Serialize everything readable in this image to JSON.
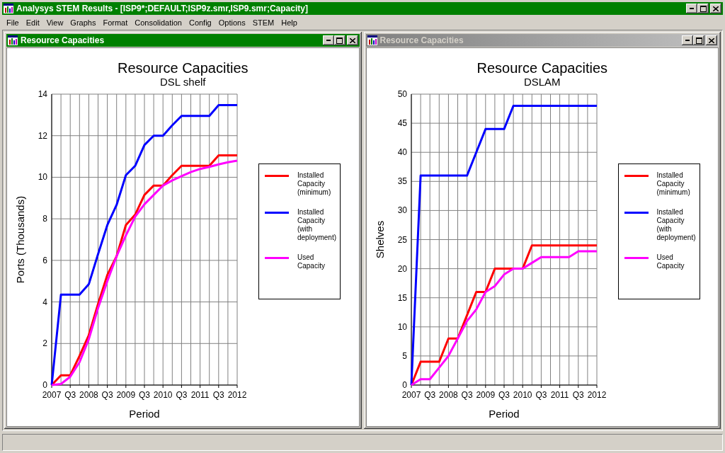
{
  "window": {
    "title": "Analysys STEM Results - [ISP9*;DEFAULT;ISP9z.smr,ISP9.smr;Capacity]",
    "active": true
  },
  "menu": [
    {
      "label": "File"
    },
    {
      "label": "Edit"
    },
    {
      "label": "View"
    },
    {
      "label": "Graphs"
    },
    {
      "label": "Format"
    },
    {
      "label": "Consolidation"
    },
    {
      "label": "Config"
    },
    {
      "label": "Options"
    },
    {
      "label": "STEM"
    },
    {
      "label": "Help"
    }
  ],
  "documents": [
    {
      "title": "Resource Capacities",
      "active": true,
      "chart_data": {
        "type": "line",
        "title": "Resource Capacities",
        "subtitle": "DSL shelf",
        "xlabel": "Period",
        "ylabel": "Ports (Thousands)",
        "grid": true,
        "legend": "right",
        "categories": [
          "2007",
          null,
          "Q3",
          null,
          "2008",
          null,
          "Q3",
          null,
          "2009",
          null,
          "Q3",
          null,
          "2010",
          null,
          "Q3",
          null,
          "2011",
          null,
          "Q3",
          null,
          "2012"
        ],
        "ylim": [
          0,
          14
        ],
        "yticks": [
          0,
          2,
          4,
          6,
          8,
          10,
          12,
          14
        ],
        "series": [
          {
            "name": "Installed Capacity (minimum)",
            "color": "#ff0000",
            "values": [
              0,
              0.47,
              0.47,
              1.4,
              2.4,
              3.9,
              5.3,
              6.2,
              7.7,
              8.2,
              9.15,
              9.6,
              9.6,
              10.1,
              10.55,
              10.55,
              10.55,
              10.55,
              11.05,
              11.05,
              11.05
            ]
          },
          {
            "name": "Installed Capacity (with deployment)",
            "color": "#0000ff",
            "values": [
              0,
              4.35,
              4.35,
              4.35,
              4.85,
              6.3,
              7.7,
              8.67,
              10.1,
              10.55,
              11.55,
              12,
              12,
              12.5,
              12.95,
              12.95,
              12.95,
              12.95,
              13.47,
              13.47,
              13.47
            ]
          },
          {
            "name": "Used Capacity",
            "color": "#ff00ff",
            "values": [
              0,
              0.05,
              0.4,
              1.1,
              2.2,
              3.7,
              5,
              6.2,
              7.2,
              8.1,
              8.7,
              9.15,
              9.6,
              9.85,
              10.05,
              10.25,
              10.4,
              10.5,
              10.62,
              10.72,
              10.8
            ]
          }
        ]
      }
    },
    {
      "title": "Resource Capacities",
      "active": false,
      "chart_data": {
        "type": "line",
        "title": "Resource Capacities",
        "subtitle": "DSLAM",
        "xlabel": "Period",
        "ylabel": "Shelves",
        "grid": true,
        "legend": "right",
        "categories": [
          "2007",
          null,
          "Q3",
          null,
          "2008",
          null,
          "Q3",
          null,
          "2009",
          null,
          "Q3",
          null,
          "2010",
          null,
          "Q3",
          null,
          "2011",
          null,
          "Q3",
          null,
          "2012"
        ],
        "ylim": [
          0,
          50
        ],
        "yticks": [
          0,
          5,
          10,
          15,
          20,
          25,
          30,
          35,
          40,
          45,
          50
        ],
        "series": [
          {
            "name": "Installed Capacity (minimum)",
            "color": "#ff0000",
            "values": [
              0,
              4,
              4,
              4,
              8,
              8,
              12,
              16,
              16,
              20,
              20,
              20,
              20,
              24,
              24,
              24,
              24,
              24,
              24,
              24,
              24
            ]
          },
          {
            "name": "Installed Capacity (with deployment)",
            "color": "#0000ff",
            "values": [
              0,
              36,
              36,
              36,
              36,
              36,
              36,
              40,
              44,
              44,
              44,
              48,
              48,
              48,
              48,
              48,
              48,
              48,
              48,
              48,
              48
            ]
          },
          {
            "name": "Used Capacity",
            "color": "#ff00ff",
            "values": [
              0,
              1,
              1,
              3,
              5,
              8,
              11,
              13,
              16,
              17,
              19,
              20,
              20,
              21,
              22,
              22,
              22,
              22,
              23,
              23,
              23
            ]
          }
        ]
      }
    }
  ]
}
